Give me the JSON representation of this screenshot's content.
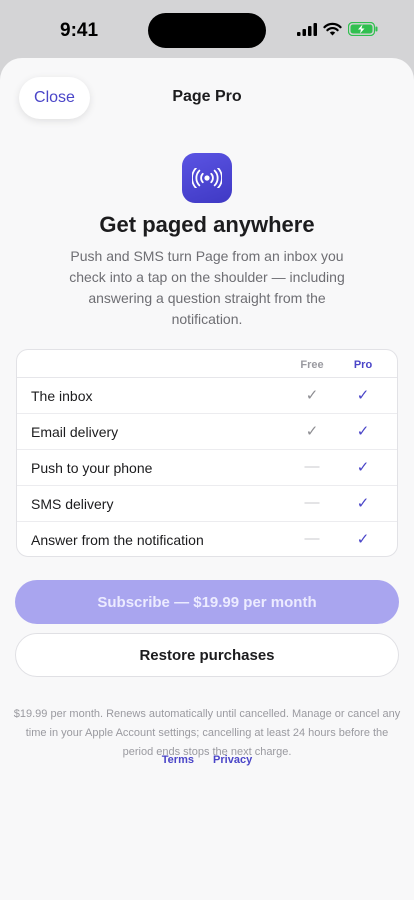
{
  "status_bar": {
    "time": "9:41",
    "icons": [
      "cellular-signal-icon",
      "wifi-icon",
      "battery-charging-icon"
    ]
  },
  "sheet": {
    "close_label": "Close",
    "title": "Page Pro"
  },
  "hero": {
    "icon": "broadcast-icon",
    "headline": "Get paged anywhere",
    "description": "Push and SMS turn Page from an inbox you check into a tap on the shoulder — including answering a question straight from the notification."
  },
  "comparison": {
    "columns": [
      "Free",
      "Pro"
    ],
    "rows": [
      {
        "feature": "The inbox",
        "free": "✓",
        "pro": "✓"
      },
      {
        "feature": "Email delivery",
        "free": "✓",
        "pro": "✓"
      },
      {
        "feature": "Push to your phone",
        "free": "—",
        "pro": "✓"
      },
      {
        "feature": "SMS delivery",
        "free": "—",
        "pro": "✓"
      },
      {
        "feature": "Answer from the notification",
        "free": "—",
        "pro": "✓"
      }
    ]
  },
  "actions": {
    "subscribe_label": "Subscribe — $19.99 per month",
    "restore_label": "Restore purchases"
  },
  "legal": {
    "text": "$19.99 per month. Renews automatically until cancelled. Manage or cancel any time in your Apple Account settings; cancelling at least 24 hours before the period ends stops the next charge.",
    "terms_label": "Terms",
    "privacy_label": "Privacy"
  },
  "colors": {
    "accent": "#4a45c8",
    "subscribe_disabled": "#a9a5ef",
    "background": "#f8f8f9"
  }
}
